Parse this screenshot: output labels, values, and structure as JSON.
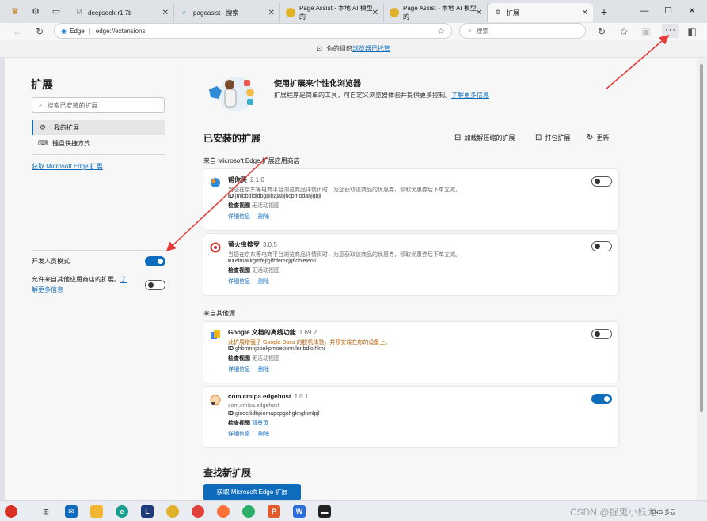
{
  "tabs": [
    {
      "label": ""
    },
    {
      "label": ""
    },
    {
      "label": "deepseek-r1:7b"
    },
    {
      "label": "pageasist - 搜索"
    },
    {
      "label": "Page Assist - 本地 AI 模型的"
    },
    {
      "label": "Page Assist - 本地 AI 模型的"
    },
    {
      "label": "扩展"
    }
  ],
  "toolbar": {
    "brand": "Edge",
    "url": "edge://extensions",
    "search_placeholder": "搜索",
    "menu_label": "···"
  },
  "infobar": {
    "text": "你的组织",
    "link": "浏览器已托管"
  },
  "sidebar": {
    "title": "扩展",
    "search_placeholder": "搜索已安装的扩展",
    "items": [
      {
        "label": "我的扩展"
      },
      {
        "label": "键盘快捷方式"
      }
    ],
    "get_link": "获取 Microsoft Edge 扩展",
    "dev_mode_label": "开发人员模式",
    "allow_text": "允许来自其他应用商店的扩展。",
    "allow_link_a": "了",
    "allow_link_b": "解更多信息"
  },
  "hero": {
    "title": "使用扩展来个性化浏览器",
    "desc": "扩展程序是简单的工具，可自定义浏览器体验并提供更多控制。",
    "learn_more": "了解更多信息"
  },
  "installed": {
    "title": "已安装的扩展",
    "actions": [
      "加载解压缩的扩展",
      "打包扩展",
      "更新"
    ],
    "store_label": "来自 Microsoft Edge 扩展应用商店",
    "other_label": "来自其他源"
  },
  "extensions": [
    {
      "name": "帮你买",
      "version": "2.1.0",
      "desc": "当您在京东等电商平台浏览商品详情页时，为您获取该商品的优惠券，领取优惠券后下单立减。",
      "id_label": "ID",
      "id": "jmjbbdididbgpihajabjhcpmodanjgbji",
      "view_label": "检查视图",
      "view": "无活动视图",
      "details": "详细信息",
      "remove": "删除",
      "enabled": false
    },
    {
      "name": "萤火虫搜罗",
      "version": "3.0.5",
      "desc": "当您在京东等电商平台浏览商品详情页时，为您获取该商品的优惠券，领取优惠券后下单立减。",
      "id_label": "ID",
      "id": "elmakkgmfejlglfhfemcjgfldbieleoii",
      "view_label": "检查视图",
      "view": "无活动视图",
      "details": "详细信息",
      "remove": "删除",
      "enabled": false
    },
    {
      "name": "Google 文档的离线功能",
      "version": "1.69.2",
      "desc": "此扩展增强了 Google Docs 的脱机体验，并预安装在你的设备上。",
      "id_label": "ID",
      "id": "ghbmnnjooekpmoecnnnilnnbdlolhkhi",
      "view_label": "检查视图",
      "view": "无活动视图",
      "details": "详细信息",
      "remove": "删除",
      "enabled": false
    },
    {
      "name": "com.cmipa.edgehost",
      "version": "1.0.1",
      "desc": "com.cmipa.edgehost",
      "id_label": "ID",
      "id": "ginecjlidbpiomapopgohgknglnmlpjl",
      "view_label": "检查视图",
      "view": "背景页",
      "details": "详细信息",
      "remove": "删除",
      "enabled": true
    }
  ],
  "find": {
    "title": "查找新扩展",
    "button": "获取 Microsoft Edge 扩展"
  },
  "taskbar": {
    "watermark": "CSDN @捉鬼小妖龙",
    "tray": "ENG 多云"
  },
  "colors": {
    "accent": "#0f6cbd",
    "annotation": "#e53935"
  }
}
